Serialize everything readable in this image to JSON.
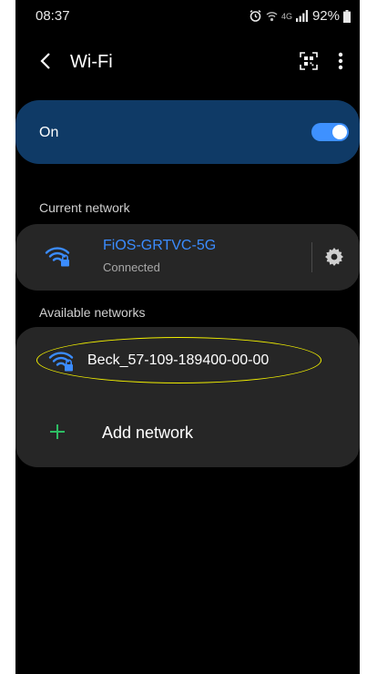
{
  "status_bar": {
    "time": "08:37",
    "network_type": "4G",
    "battery": "92%",
    "icons": [
      "alarm-icon",
      "wifi-call-icon",
      "signal-icon",
      "battery-icon"
    ]
  },
  "app_bar": {
    "title": "Wi-Fi",
    "icons": [
      "back-arrow-icon",
      "qr-scan-icon",
      "more-options-icon"
    ]
  },
  "wifi_toggle": {
    "label": "On",
    "enabled": true
  },
  "current_network": {
    "section_label": "Current network",
    "ssid": "FiOS-GRTVC-5G",
    "status": "Connected",
    "icons": [
      "wifi-locked-icon",
      "gear-icon"
    ]
  },
  "available_networks": {
    "section_label": "Available networks",
    "items": [
      {
        "ssid": "Beck_57-109-189400-00-00",
        "icon": "wifi-locked-icon"
      }
    ],
    "add_network_label": "Add network"
  },
  "colors": {
    "background": "#000000",
    "toggle_card": "#0f3a66",
    "accent_blue": "#3b8cff",
    "card": "#262626",
    "add_icon": "#2dbd63",
    "annotation": "#f2f000"
  }
}
